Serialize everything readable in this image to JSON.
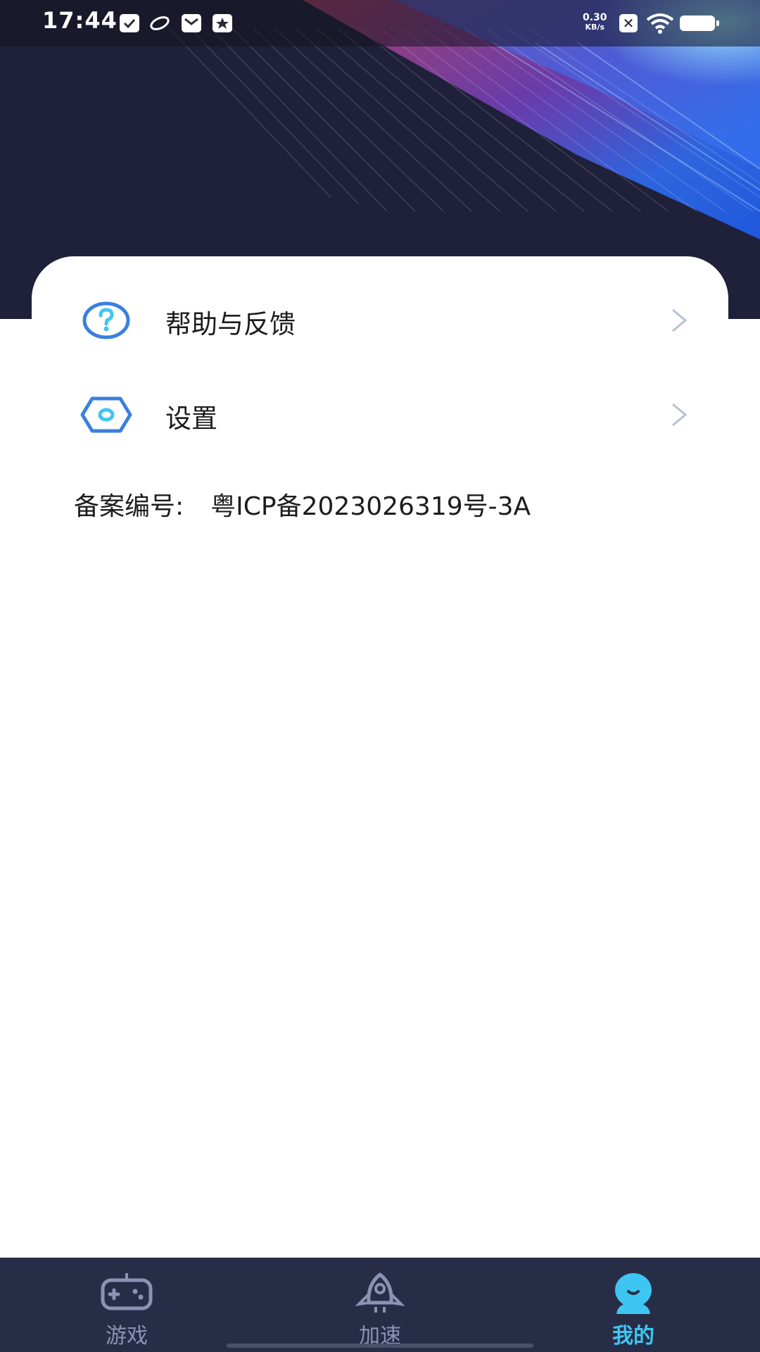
{
  "status_bar": {
    "time": "17:44",
    "net_speed_value": "0.30",
    "net_speed_unit": "KB/s",
    "icons": [
      "clipboard-check-icon",
      "orbit-icon",
      "mail-icon",
      "star-message-icon",
      "close-box-icon",
      "wifi-icon",
      "battery-icon"
    ]
  },
  "menu": {
    "items": [
      {
        "label": "帮助与反馈",
        "icon": "help-icon"
      },
      {
        "label": "设置",
        "icon": "settings-hex-icon"
      }
    ]
  },
  "icp": {
    "label": "备案编号:",
    "value": "粤ICP备2023026319号-3A"
  },
  "bottom_nav": {
    "tabs": [
      {
        "label": "游戏",
        "icon": "gamepad-icon"
      },
      {
        "label": "加速",
        "icon": "rocket-icon"
      },
      {
        "label": "我的",
        "icon": "profile-icon"
      }
    ],
    "active_index": 2
  },
  "colors": {
    "accent": "#3ec6f2",
    "icon_blue": "#3a7fe0",
    "nav_bg": "#282d47",
    "banner_bg": "#1f2039"
  }
}
